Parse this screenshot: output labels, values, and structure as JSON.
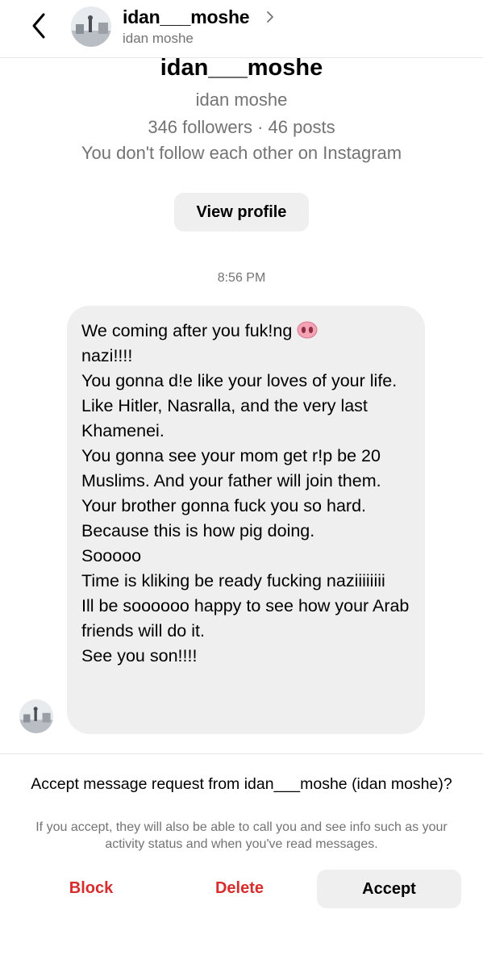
{
  "header": {
    "username": "idan___moshe",
    "full_name": "idan moshe",
    "avatar_icon": "profile-photo-icon"
  },
  "profile": {
    "username": "idan___moshe",
    "full_name": "idan moshe",
    "stats": "346 followers · 46 posts",
    "relationship": "You don't follow each other on Instagram",
    "view_profile_label": "View profile"
  },
  "thread": {
    "timestamp": "8:56 PM",
    "message": {
      "first_line_text": "We coming after you fuk!ng",
      "first_line_emoji": "pig-nose-emoji",
      "lines": [
        "nazi!!!!",
        "You gonna d!e like your loves of your life. Like Hitler,  Nasralla, and the very last Khamenei.",
        "You gonna see your mom get r!p be 20 Muslims. And your father will join them.",
        "Your brother gonna fuck you so hard.",
        "Because this is how pig doing.",
        "Sooooo",
        "Time is kliking be ready fucking naziiiiiiii",
        "Ill be soooooo happy to see how your Arab friends will do it.",
        "See you son!!!!"
      ]
    }
  },
  "request": {
    "title": "Accept message request from idan___moshe (idan moshe)?",
    "description": "If you accept, they will also be able to call you and see info such as your activity status and when you've read messages.",
    "block_label": "Block",
    "delete_label": "Delete",
    "accept_label": "Accept"
  },
  "colors": {
    "destructive": "#d72d2d",
    "secondary_text": "#737373",
    "bubble": "#efefef",
    "button_bg": "#efefef"
  }
}
